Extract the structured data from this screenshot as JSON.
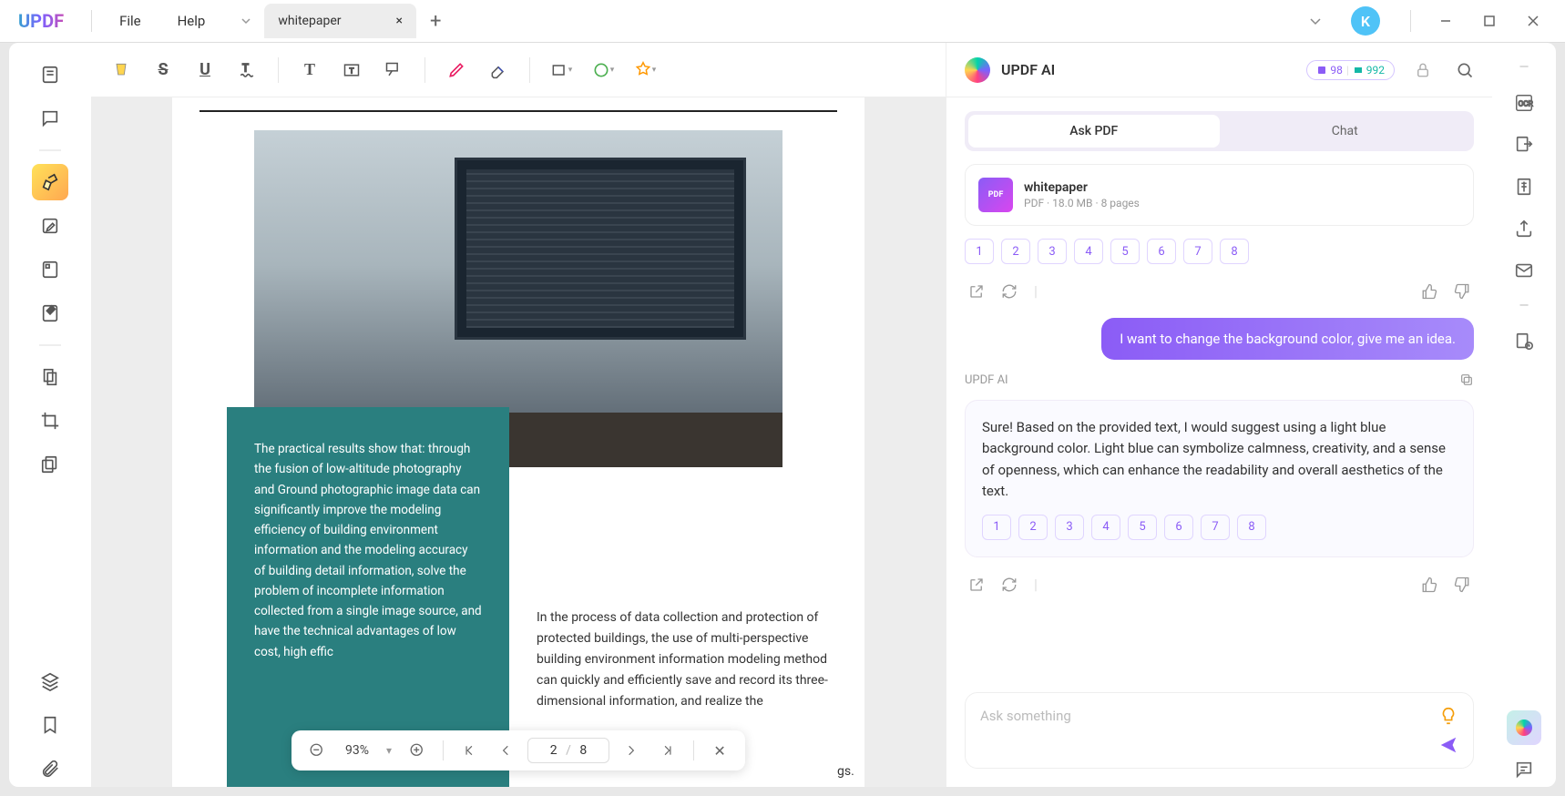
{
  "app": {
    "logo": "UPDF",
    "menus": {
      "file": "File",
      "help": "Help"
    }
  },
  "tab": {
    "title": "whitepaper"
  },
  "avatar": {
    "initial": "K"
  },
  "doc": {
    "teal_text": "The practical results show that: through the fusion of low-altitude photography and Ground photographic image data can significantly improve the modeling efficiency of building environment information and the modeling accuracy of building detail information, solve the problem of incomplete information collected from a single image source, and have the technical advantages of low cost, high effic",
    "body_text": "In the process of data collection and protection of protected buildings, the use of multi-perspective building environment information modeling method can quickly and efficiently save and record its three-dimensional information, and realize the",
    "body_tail": "gs."
  },
  "page_controls": {
    "zoom": "93%",
    "page_current": "2",
    "page_sep": "/",
    "page_total": "8"
  },
  "ai": {
    "title": "UPDF AI",
    "credits": {
      "purple": "98",
      "teal": "992"
    },
    "seg": {
      "ask": "Ask PDF",
      "chat": "Chat"
    },
    "file": {
      "name": "whitepaper",
      "meta": "PDF · 18.0 MB · 8 pages",
      "badge": "PDF"
    },
    "pages": [
      "1",
      "2",
      "3",
      "4",
      "5",
      "6",
      "7",
      "8"
    ],
    "user_msg": "I want to change the background color, give me an idea.",
    "ai_label": "UPDF AI",
    "ai_msg": "Sure! Based on the provided text, I would suggest using a light blue background color. Light blue can symbolize calmness, creativity, and a sense of openness, which can enhance the readability and overall aesthetics of the text.",
    "placeholder": "Ask something"
  }
}
